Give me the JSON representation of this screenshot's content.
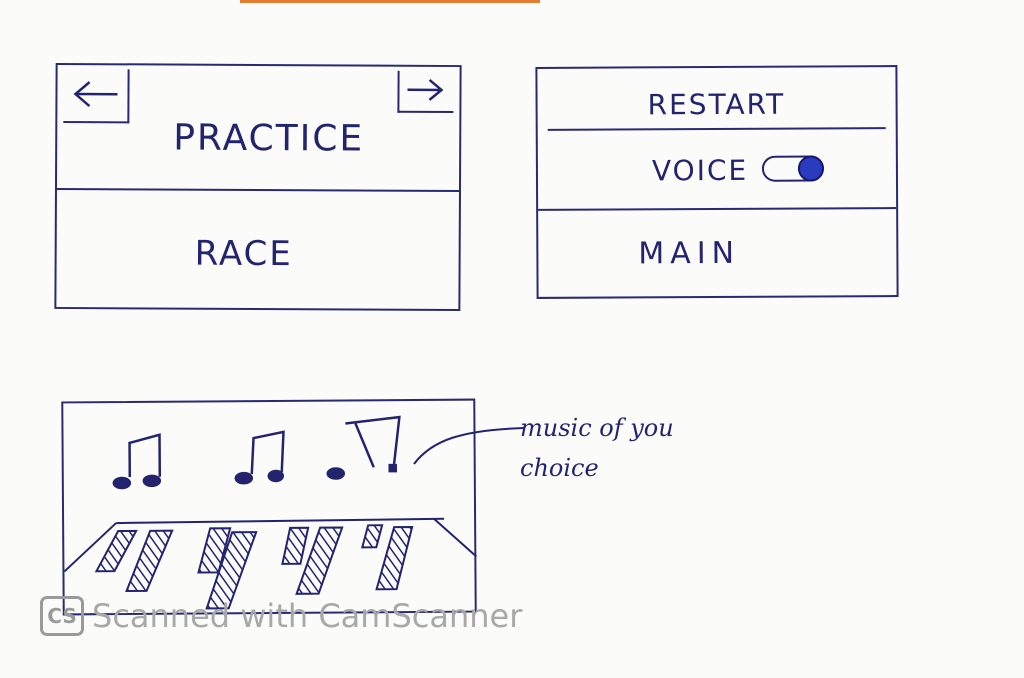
{
  "screens": {
    "menu": {
      "back_icon": "left-arrow-icon",
      "forward_icon": "right-arrow-icon",
      "practice_label": "PRACTICE",
      "race_label": "RACE"
    },
    "pause": {
      "restart_label": "RESTART",
      "voice_label": "VOICE",
      "main_label": "MAIN",
      "voice_toggle_on": true
    },
    "game": {
      "annotation": "music of you choice",
      "note_icon": "music-note-icon"
    }
  },
  "watermark": {
    "logo": "CS",
    "text": "Scanned with CamScanner"
  },
  "colors": {
    "ink": "#24246e",
    "toggle": "#2a3bbf",
    "top_bar": "#e67b32"
  }
}
